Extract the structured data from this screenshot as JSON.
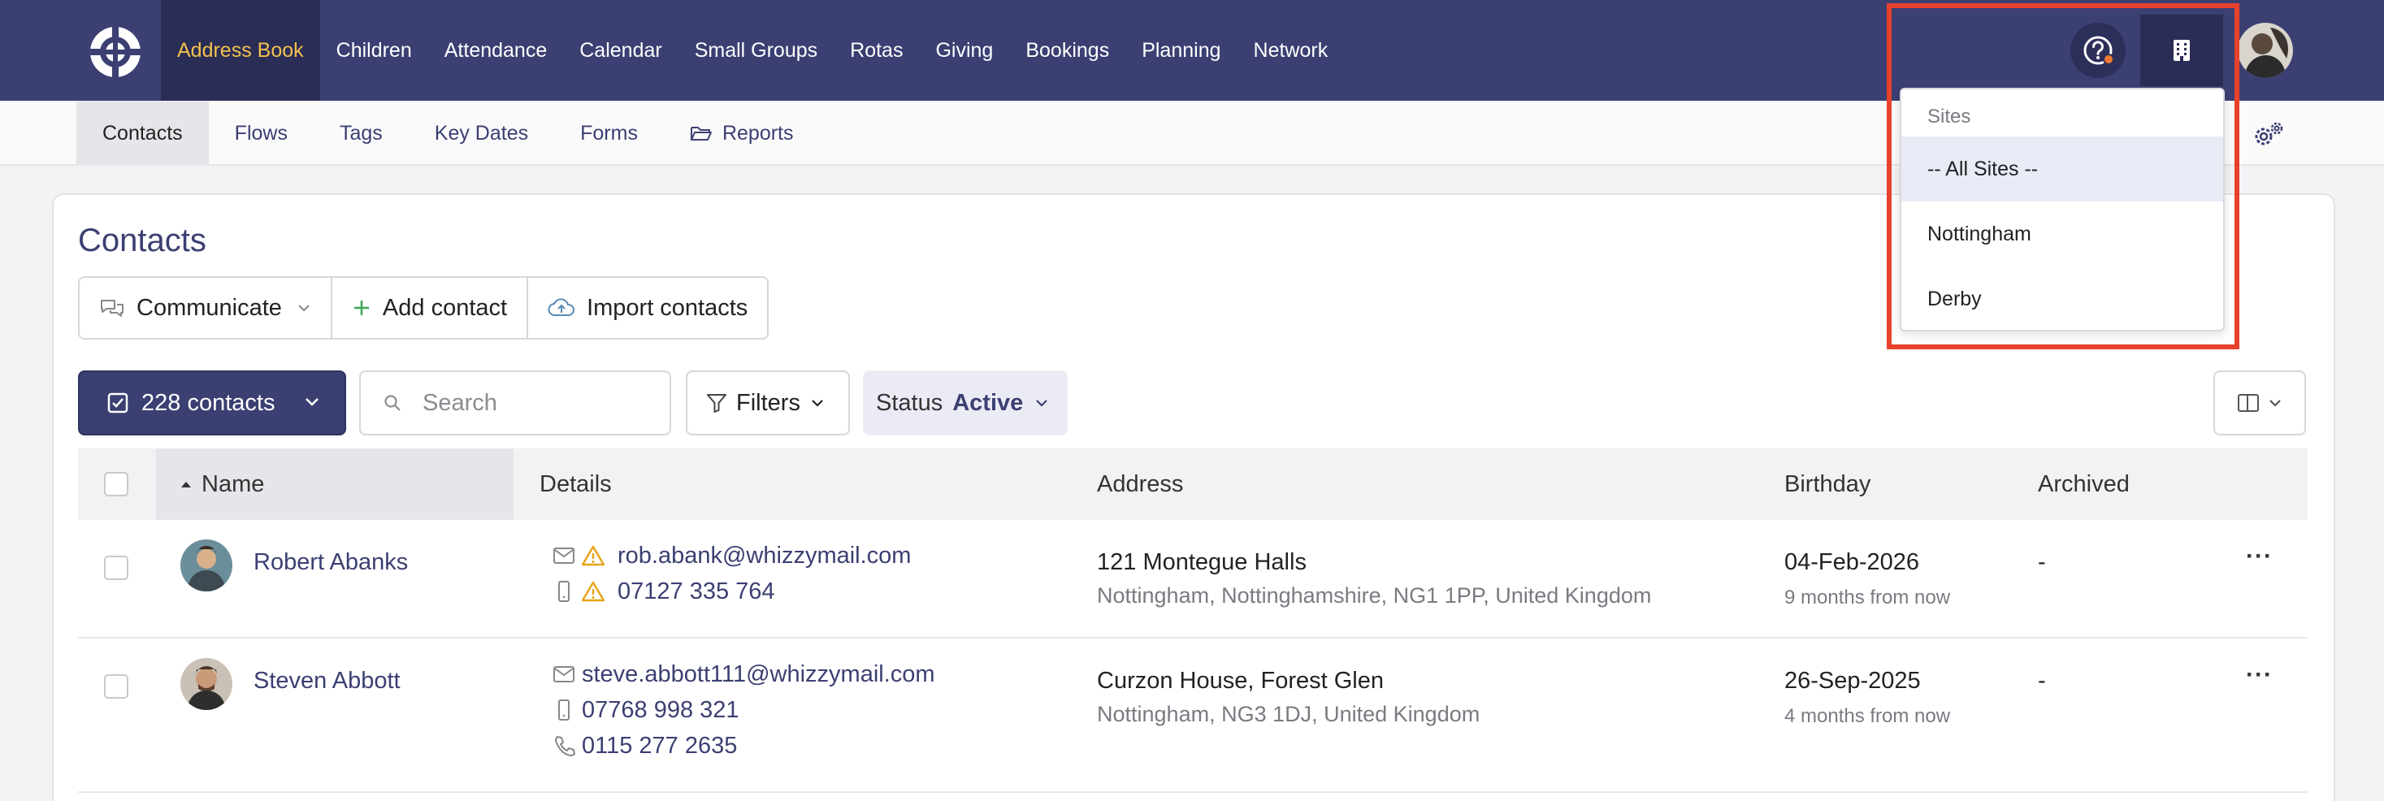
{
  "topnav": {
    "items": [
      {
        "label": "Address Book",
        "active": true
      },
      {
        "label": "Children"
      },
      {
        "label": "Attendance"
      },
      {
        "label": "Calendar"
      },
      {
        "label": "Small Groups"
      },
      {
        "label": "Rotas"
      },
      {
        "label": "Giving"
      },
      {
        "label": "Bookings"
      },
      {
        "label": "Planning"
      },
      {
        "label": "Network"
      }
    ],
    "icons": [
      "logo-icon",
      "help-icon",
      "building-icon",
      "user-avatar"
    ]
  },
  "subnav": {
    "items": [
      {
        "label": "Contacts",
        "active": true
      },
      {
        "label": "Flows"
      },
      {
        "label": "Tags"
      },
      {
        "label": "Key Dates"
      },
      {
        "label": "Forms"
      },
      {
        "label": "Reports",
        "icon": "folder-open-icon"
      }
    ]
  },
  "page": {
    "title": "Contacts",
    "actions": {
      "communicate": "Communicate",
      "add_contact": "Add contact",
      "import_contacts": "Import contacts"
    },
    "toolbar": {
      "contacts_count": "228 contacts",
      "search_placeholder": "Search",
      "filters": "Filters",
      "status_label": "Status",
      "status_value": "Active"
    }
  },
  "table": {
    "columns": [
      "Name",
      "Details",
      "Address",
      "Birthday",
      "Archived"
    ],
    "rows": [
      {
        "name": "Robert Abanks",
        "email": "rob.abank@whizzymail.com",
        "mobile": "07127 335 764",
        "address_line1": "121 Montegue Halls",
        "address_line2": "Nottingham, Nottinghamshire, NG1 1PP, United Kingdom",
        "birthday": "04-Feb-2026",
        "birthday_relative": "9 months from now",
        "archived": "-"
      },
      {
        "name": "Steven Abbott",
        "email": "steve.abbott111@whizzymail.com",
        "mobile": "07768 998 321",
        "phone": "0115 277 2635",
        "address_line1": "Curzon House, Forest Glen",
        "address_line2": "Nottingham, NG3 1DJ, United Kingdom",
        "birthday": "26-Sep-2025",
        "birthday_relative": "4 months from now",
        "archived": "-"
      }
    ]
  },
  "sites_dropdown": {
    "header": "Sites",
    "options": [
      "-- All Sites --",
      "Nottingham",
      "Derby"
    ],
    "selected": "-- All Sites --"
  },
  "colors": {
    "nav_bg": "#3b3f72",
    "active_nav_text": "#f2c14e",
    "highlight": "#e8412c",
    "warning": "#e6a317"
  }
}
